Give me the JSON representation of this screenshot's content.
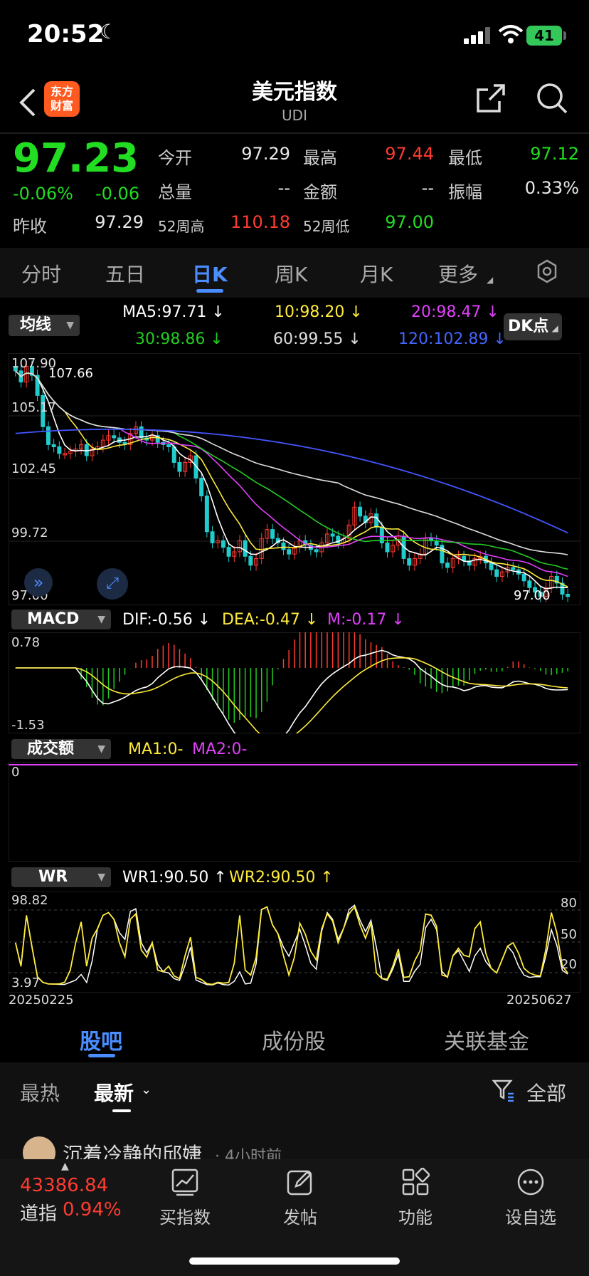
{
  "status": {
    "time": "20:52",
    "battery": "41"
  },
  "header": {
    "title": "美元指数",
    "code": "UDI",
    "logo_text": "东方财富"
  },
  "quote": {
    "price": "97.23",
    "change_pct": "-0.06%",
    "change": "-0.06",
    "prev_close_label": "昨收",
    "prev_close": "97.29",
    "open_label": "今开",
    "open": "97.29",
    "high_label": "最高",
    "high": "97.44",
    "low_label": "最低",
    "low": "97.12",
    "volume_label": "总量",
    "volume": "--",
    "amount_label": "金额",
    "amount": "--",
    "amplitude_label": "振幅",
    "amplitude": "0.33%",
    "w52_high_label": "52周高",
    "w52_high": "110.18",
    "w52_low_label": "52周低",
    "w52_low": "97.00"
  },
  "period_tabs": [
    "分时",
    "五日",
    "日K",
    "周K",
    "月K",
    "更多"
  ],
  "ma": {
    "selector": "均线",
    "ma5": "MA5:97.71",
    "ma10": "10:98.20",
    "ma20": "20:98.47",
    "ma30": "30:98.86",
    "ma60": "60:99.55",
    "ma120": "120:102.89",
    "dk_button": "DK点",
    "colors": {
      "ma5": "#ffffff",
      "ma10": "#ffeb3b",
      "ma20": "#e040fb",
      "ma30": "#22cc22",
      "ma60": "#dddddd",
      "ma120": "#4455ff"
    }
  },
  "macd": {
    "selector": "MACD",
    "dif": "DIF:-0.56",
    "dea": "DEA:-0.47",
    "m": "M:-0.17",
    "top": "0.78",
    "bottom": "-1.53"
  },
  "turnover": {
    "selector": "成交额",
    "ma1": "MA1:0-",
    "ma2": "MA2:0-",
    "zero": "0"
  },
  "wr": {
    "selector": "WR",
    "wr1": "WR1:90.50",
    "wr2": "WR2:90.50",
    "top": "98.82",
    "bottom": "3.97",
    "lv80": "80",
    "lv50": "50",
    "lv20": "20"
  },
  "dates": {
    "start": "20250225",
    "end": "20250627"
  },
  "bottom_tabs": [
    "股吧",
    "成份股",
    "关联基金"
  ],
  "sort": {
    "hot": "最热",
    "new": "最新",
    "filter": "全部"
  },
  "post": {
    "user": "沉着冷静的邱婕",
    "time": "· 4小时前"
  },
  "tabbar": {
    "ticker_value": "43386.84",
    "ticker_name": "道指",
    "ticker_pct": "0.94%",
    "items": [
      "买指数",
      "发帖",
      "功能",
      "设自选"
    ]
  },
  "chart_data": {
    "type": "candlestick",
    "y_labels": [
      "107.90",
      "105.17",
      "102.45",
      "99.72",
      "97.00"
    ],
    "annotations": {
      "high_label": "107.66",
      "last_label": "97.00"
    },
    "ylim": [
      97.0,
      107.9
    ],
    "close": [
      107.3,
      106.8,
      107.5,
      107.1,
      106.2,
      104.8,
      104.0,
      103.9,
      103.6,
      103.6,
      103.7,
      103.8,
      104.0,
      103.5,
      103.8,
      103.9,
      104.2,
      104.4,
      104.3,
      104.1,
      104.0,
      104.5,
      104.8,
      104.3,
      104.2,
      104.4,
      104.1,
      104.0,
      103.9,
      103.2,
      102.8,
      103.2,
      103.5,
      102.5,
      101.7,
      100.1,
      99.6,
      99.7,
      99.4,
      99.0,
      99.2,
      99.7,
      99.0,
      98.6,
      98.9,
      99.8,
      100.2,
      99.8,
      99.6,
      99.3,
      99.1,
      99.4,
      99.7,
      99.5,
      99.3,
      99.2,
      99.6,
      100.0,
      99.9,
      99.6,
      99.8,
      100.4,
      101.2,
      100.8,
      100.5,
      100.9,
      100.3,
      99.6,
      99.2,
      99.5,
      99.9,
      98.9,
      98.6,
      98.9,
      99.1,
      99.8,
      99.7,
      99.5,
      98.7,
      98.5,
      98.9,
      99.0,
      98.8,
      98.6,
      98.9,
      99.0,
      98.7,
      98.4,
      98.1,
      98.3,
      98.5,
      98.4,
      98.2,
      97.9,
      97.6,
      97.4,
      97.2,
      97.6,
      98.1,
      97.8,
      97.3,
      97.2
    ],
    "ma5_color": "#ffffff",
    "ma10_color": "#ffeb3b",
    "ma20_color": "#e040fb",
    "ma30_color": "#22cc22",
    "ma60_color": "#dddddd",
    "ma120_color": "#4455ff",
    "up_color": "#ff3b30",
    "down_color": "#22cccc"
  }
}
